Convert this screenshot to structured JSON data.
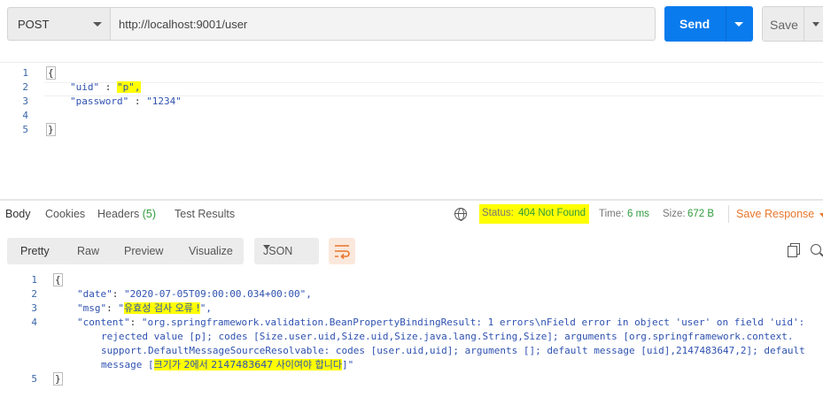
{
  "request": {
    "method": "POST",
    "url": "http://localhost:9001/user",
    "send_label": "Send",
    "save_label": "Save"
  },
  "request_body": {
    "line_numbers": [
      "1",
      "2",
      "3",
      "4",
      "5"
    ],
    "lines": {
      "l1": "{",
      "l2_key": "\"uid\"",
      "l2_sep": " : ",
      "l2_val": "\"p\",",
      "l3_key": "\"password\"",
      "l3_sep": " : ",
      "l3_val": "\"1234\"",
      "l5": "}"
    }
  },
  "response_tabs": {
    "body": "Body",
    "cookies": "Cookies",
    "headers": "Headers",
    "headers_count": "(5)",
    "test_results": "Test Results"
  },
  "response_meta": {
    "status_label": "Status:",
    "status_value": "404 Not Found",
    "time_label": "Time:",
    "time_value": "6 ms",
    "size_label": "Size:",
    "size_value": "672 B",
    "save_response": "Save Response"
  },
  "response_toolbar": {
    "views": [
      "Pretty",
      "Raw",
      "Preview",
      "Visualize"
    ],
    "format": "JSON"
  },
  "response_body": {
    "line_numbers": [
      "1",
      "2",
      "3",
      "4",
      "5"
    ],
    "date_key": "\"date\"",
    "date_val": "\"2020-07-05T09:00:00.034+00:00\",",
    "msg_key": "\"msg\"",
    "msg_val_open": "\"",
    "msg_val_hl": "유효성 검사 오류 !",
    "msg_val_close": "\",",
    "content_key": "\"content\"",
    "content_l1": "\"org.springframework.validation.BeanPropertyBindingResult: 1 errors\\nField error in object 'user' on field 'uid':",
    "content_l2": "rejected value [p]; codes [Size.user.uid,Size.uid,Size.java.lang.String,Size]; arguments [org.springframework.context.",
    "content_l3": "support.DefaultMessageSourceResolvable: codes [user.uid,uid]; arguments []; default message [uid],2147483647,2]; default",
    "content_l4_pre": "message [",
    "content_l4_hl": "크기가 2에서 2147483647 사이여야 합니다",
    "content_l4_post": "]\"",
    "open_brace": "{",
    "close_brace": "}"
  },
  "colors": {
    "send": "#097bed",
    "highlight": "#ffff00",
    "status_ok": "#2f9b3e",
    "save_response": "#e8772c"
  }
}
